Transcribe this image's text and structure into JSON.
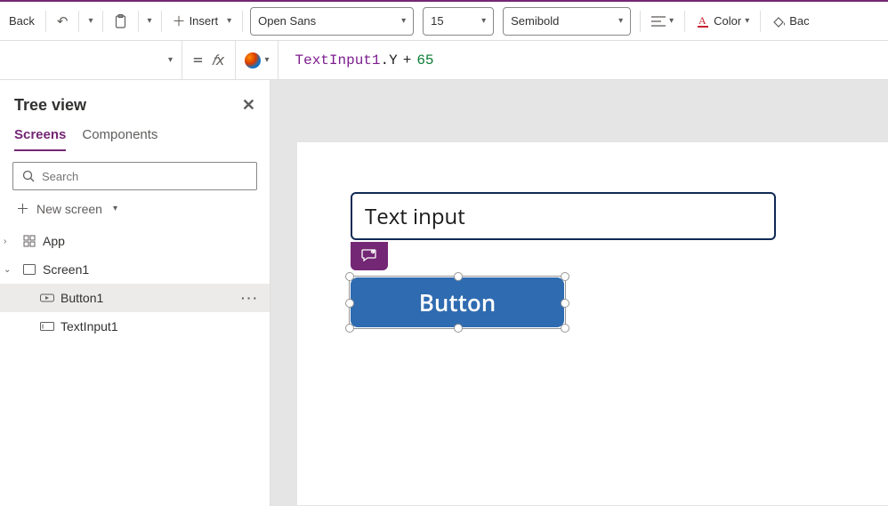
{
  "ribbon": {
    "back": "Back",
    "insert": "Insert",
    "font_family": "Open Sans",
    "font_size": "15",
    "font_weight": "Semibold",
    "color": "Color",
    "back_right": "Bac"
  },
  "formula": {
    "equals": "=",
    "fx": "𝑓x",
    "control": "TextInput1",
    "dot": ".",
    "property": "Y",
    "operator": "+",
    "value": "65"
  },
  "tree": {
    "title": "Tree view",
    "tab_screens": "Screens",
    "tab_components": "Components",
    "search_placeholder": "Search",
    "new_screen": "New screen",
    "nodes": {
      "app": "App",
      "screen1": "Screen1",
      "button1": "Button1",
      "textinput1": "TextInput1"
    },
    "more": "···"
  },
  "canvas": {
    "textinput_value": "Text input",
    "button_label": "Button"
  }
}
